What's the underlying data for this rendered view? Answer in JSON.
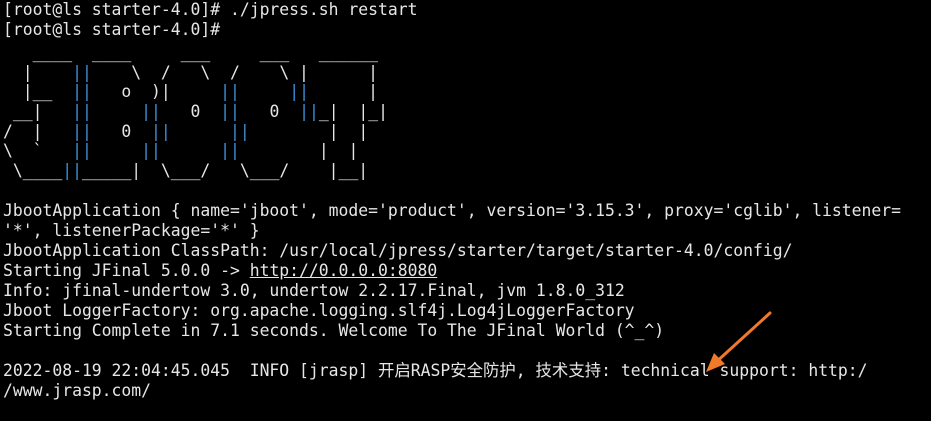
{
  "terminal": {
    "lines_top": [
      "[root@ls starter-4.0]# ./jpress.sh restart",
      "[root@ls starter-4.0]# "
    ],
    "banner": [
      [
        {
          "t": "   ____ ",
          "c": "w"
        },
        {
          "t": " ____  ",
          "c": "w"
        },
        {
          "t": "   ___  ",
          "c": "w"
        },
        {
          "t": "   ___  ",
          "c": "w"
        },
        {
          "t": " ______ ",
          "c": "w"
        }
      ],
      [
        {
          "t": "  |    ",
          "c": "w"
        },
        {
          "t": "||",
          "c": "b"
        },
        {
          "t": "    \\  /   \\  /    \\ |      |",
          "c": "w"
        }
      ],
      [
        {
          "t": "  |__  ",
          "c": "w"
        },
        {
          "t": "||",
          "c": "b"
        },
        {
          "t": "   o  )|     ",
          "c": "w"
        },
        {
          "t": "||",
          "c": "b"
        },
        {
          "t": "     ",
          "c": "w"
        },
        {
          "t": "||",
          "c": "b"
        },
        {
          "t": "      |",
          "c": "w"
        }
      ],
      [
        {
          "t": " __|   ",
          "c": "w"
        },
        {
          "t": "||",
          "c": "b"
        },
        {
          "t": "     ",
          "c": "w"
        },
        {
          "t": "||",
          "c": "b"
        },
        {
          "t": "   0  ",
          "c": "w"
        },
        {
          "t": "||",
          "c": "b"
        },
        {
          "t": "   0  ",
          "c": "w"
        },
        {
          "t": "||",
          "c": "b"
        },
        {
          "t": "_|  |_|",
          "c": "w"
        }
      ],
      [
        {
          "t": "/  |   ",
          "c": "w"
        },
        {
          "t": "||",
          "c": "b"
        },
        {
          "t": "   0  ",
          "c": "w"
        },
        {
          "t": "||",
          "c": "b"
        },
        {
          "t": "      ",
          "c": "w"
        },
        {
          "t": "||",
          "c": "b"
        },
        {
          "t": "        |  |",
          "c": "w"
        }
      ],
      [
        {
          "t": "\\  `   ",
          "c": "w"
        },
        {
          "t": "||",
          "c": "b"
        },
        {
          "t": "     ",
          "c": "w"
        },
        {
          "t": "||",
          "c": "b"
        },
        {
          "t": "      ",
          "c": "w"
        },
        {
          "t": "||",
          "c": "b"
        },
        {
          "t": "        |  |",
          "c": "w"
        }
      ],
      [
        {
          "t": " \\____",
          "c": "w"
        },
        {
          "t": "||",
          "c": "b"
        },
        {
          "t": "_____|  \\___/   \\___/    |__|",
          "c": "w"
        }
      ]
    ],
    "output_lines": [
      "JbootApplication { name='jboot', mode='product', version='3.15.3', proxy='cglib', listener=",
      "'*', listenerPackage='*' }",
      "JbootApplication ClassPath: /usr/local/jpress/starter/target/starter-4.0/config/"
    ],
    "starting_prefix": "Starting JFinal 5.0.0 -> ",
    "starting_link": "http://0.0.0.0:8080",
    "output_lines_2": [
      "Info: jfinal-undertow 3.0, undertow 2.2.17.Final, jvm 1.8.0_312",
      "Jboot LoggerFactory: org.apache.logging.slf4j.Log4jLoggerFactory",
      "Starting Complete in 7.1 seconds. Welcome To The JFinal World (^_^)"
    ],
    "log_lines": [
      "2022-08-19 22:04:45.045  INFO [jrasp] 开启RASP安全防护, 技术支持: technical support: http:/",
      "/www.jrasp.com/"
    ]
  },
  "colors": {
    "background": "#000000",
    "text": "#e6e6e6",
    "banner_accent": "#3d8fd6",
    "annotation_arrow": "#f07a2a"
  }
}
